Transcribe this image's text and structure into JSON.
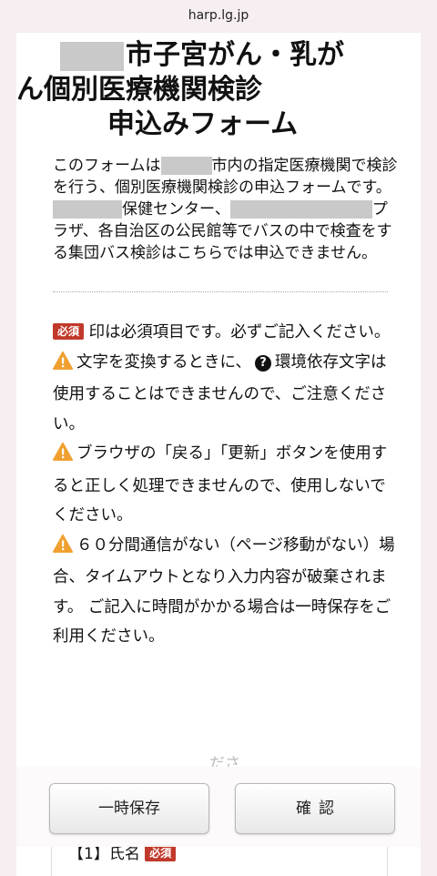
{
  "browser": {
    "url": "harp.lg.jp"
  },
  "form": {
    "title_line1": "市子宮がん・乳が",
    "title_line2": "ん個別医療機関検診",
    "title_line3": "申込みフォーム"
  },
  "intro": {
    "p1_a": "このフォームは",
    "p1_b": "市内の指定医療機関で検診を行う、個別医療機関検診の申込フォームです。",
    "p2_a": "保健センター、",
    "p2_b": "プラザ、各自治区の公民館等でバスの中で検査をする集団バス検診はこちらでは申込できません。"
  },
  "notes": {
    "required_badge": "必須",
    "required_text": "印は必須項目です。必ずご記入ください。",
    "char_a": "文字を変換するときに、",
    "char_b": "環境依存文字は使用することはできませんので、ご注意ください。",
    "browser_note": "ブラウザの「戻る」「更新」ボタンを使用すると正しく処理できませんので、使用しないでください。",
    "timeout_note": "６０分間通信がない（ページ移動がない）場合、タイムアウトとなり入力内容が破棄されます。 ご記入に時間がかかる場合は一時保存をご利用ください。"
  },
  "faded_text": "ださ",
  "actions": {
    "save_label": "一時保存",
    "confirm_label": "確認"
  },
  "field1": {
    "label": "【1】氏名",
    "badge": "必須"
  },
  "colors": {
    "badge": "#c0392b",
    "warning": "#f0a030",
    "redaction": "#c9c9c9"
  }
}
